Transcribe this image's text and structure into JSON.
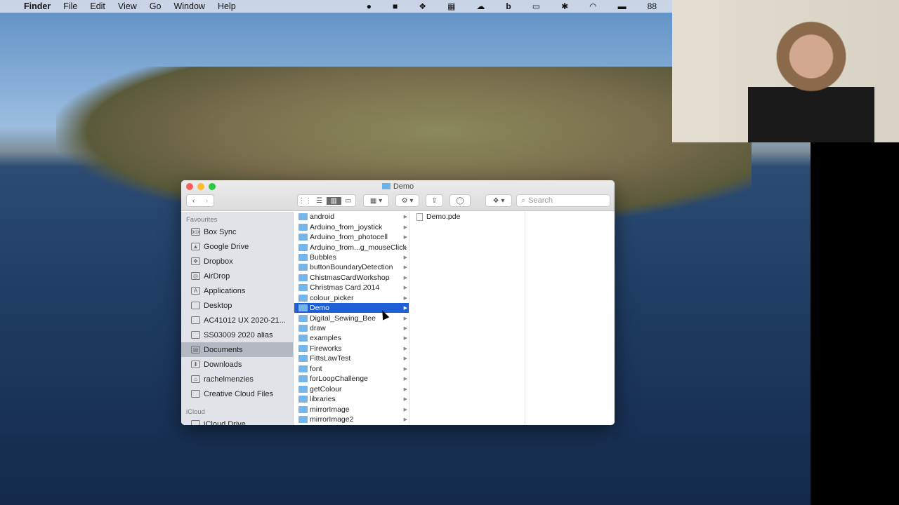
{
  "menubar": {
    "app": "Finder",
    "items": [
      "File",
      "Edit",
      "View",
      "Go",
      "Window",
      "Help"
    ],
    "status_text": "88"
  },
  "window": {
    "title": "Demo",
    "search_placeholder": "Search"
  },
  "sidebar": {
    "favourites_header": "Favourites",
    "items": [
      {
        "label": "Box Sync",
        "icon": "box"
      },
      {
        "label": "Google Drive",
        "icon": "▲"
      },
      {
        "label": "Dropbox",
        "icon": "❖"
      },
      {
        "label": "AirDrop",
        "icon": "◎"
      },
      {
        "label": "Applications",
        "icon": "A"
      },
      {
        "label": "Desktop",
        "icon": ""
      },
      {
        "label": "AC41012 UX 2020-21...",
        "icon": ""
      },
      {
        "label": "SS03009 2020 alias",
        "icon": ""
      },
      {
        "label": "Documents",
        "icon": "▤",
        "selected": true
      },
      {
        "label": "Downloads",
        "icon": "⬇"
      },
      {
        "label": "rachelmenzies",
        "icon": "⌂"
      },
      {
        "label": "Creative Cloud Files",
        "icon": ""
      }
    ],
    "icloud_header": "iCloud",
    "icloud_items": [
      "iCloud Drive"
    ]
  },
  "column1": [
    "android",
    "Arduino_from_joystick",
    "Arduino_from_photocell",
    "Arduino_from...g_mouseClick",
    "Bubbles",
    "buttonBoundaryDetection",
    "ChistmasCardWorkshop",
    "Christmas Card 2014",
    "colour_picker",
    "Demo",
    "Digital_Sewing_Bee",
    "draw",
    "examples",
    "Fireworks",
    "FittsLawTest",
    "font",
    "forLoopChallenge",
    "getColour",
    "libraries",
    "mirrorImage",
    "mirrorImage2"
  ],
  "selected_folder": "Demo",
  "column2": [
    "Demo.pde"
  ]
}
